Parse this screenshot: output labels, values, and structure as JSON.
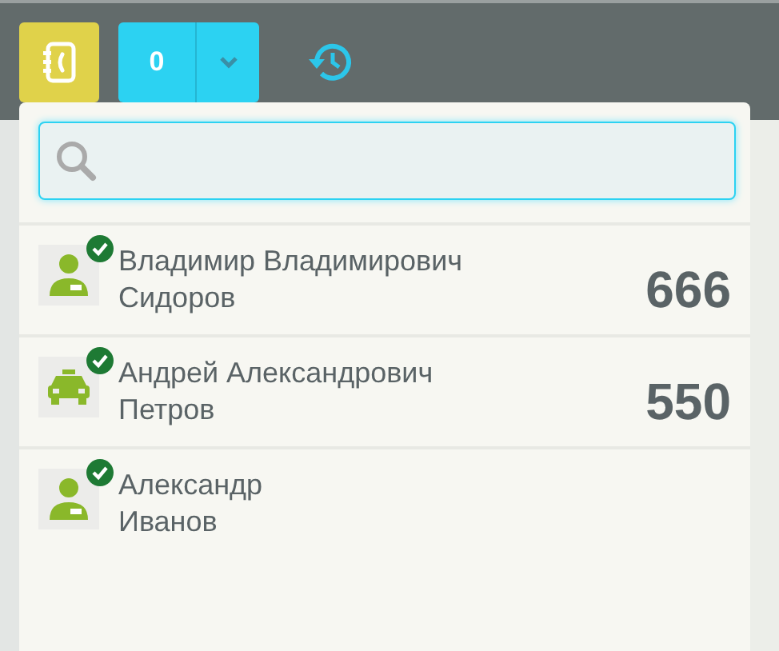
{
  "toolbar": {
    "counter": "0"
  },
  "drivers": [
    {
      "kind": "person",
      "online": true,
      "first_line": "Владимир Владимирович",
      "second_line": "Сидоров",
      "number": "666"
    },
    {
      "kind": "car",
      "online": true,
      "first_line": "Андрей Александрович",
      "second_line": "Петров",
      "number": "550"
    },
    {
      "kind": "person",
      "online": true,
      "first_line": "Александр",
      "second_line": "Иванов"
    }
  ]
}
